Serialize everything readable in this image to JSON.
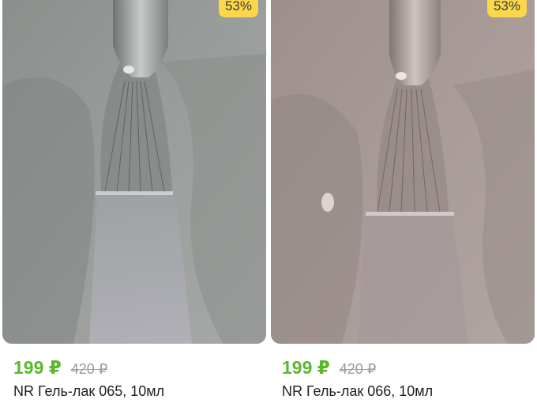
{
  "colors": {
    "discount_badge_bg": "#fbd84b",
    "price_green": "#5bb72f",
    "old_price_gray": "#9b9b9b",
    "title_text": "#1f1f1f"
  },
  "products": [
    {
      "discount": "53%",
      "price": "199 ₽",
      "old_price": "420 ₽",
      "title": "NR Гель-лак 065, 10мл",
      "swatch": "gray-polish"
    },
    {
      "discount": "53%",
      "price": "199 ₽",
      "old_price": "420 ₽",
      "title": "NR Гель-лак 066, 10мл",
      "swatch": "taupe-polish"
    }
  ]
}
